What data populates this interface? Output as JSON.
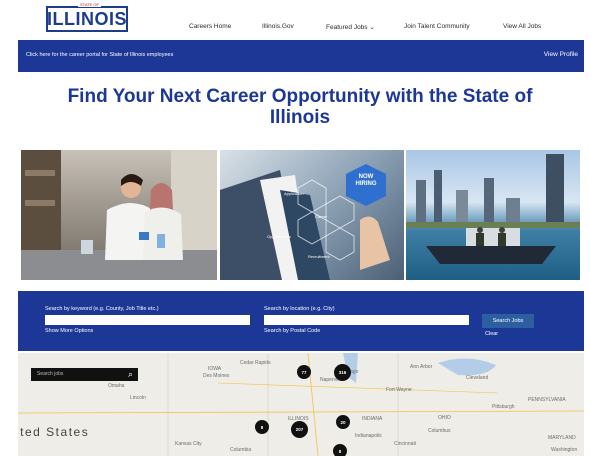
{
  "header": {
    "logo_text": "ILLINOIS",
    "logo_small": "STATE OF",
    "nav": [
      "Careers Home",
      "Illinois.Gov",
      "Featured Jobs ⌄",
      "Join Talent Community",
      "View All Jobs"
    ]
  },
  "employee_bar": {
    "left_link": "Click here for the career portal for State of Illinois employees",
    "right_link": "View Profile"
  },
  "headline": "Find Your Next Career Opportunity with the State of Illinois",
  "photos": {
    "middle": {
      "badge": "NOW HIRING",
      "hex_labels": [
        "Career",
        "Opportunities",
        "Application",
        "Recruitment"
      ]
    }
  },
  "search": {
    "keyword_label": "Search by keyword (e.g. County, Job Title etc.)",
    "keyword_value": "",
    "location_label": "Search by location (e.g. City)",
    "location_value": "",
    "show_more": "Show More Options",
    "postal": "Search by Postal Code",
    "button": "Search Jobs",
    "clear": "Clear"
  },
  "map": {
    "search_placeholder": "Search jobs",
    "country_label": "ited States",
    "places": [
      "IOWA",
      "Des Moines",
      "Cedar Rapids",
      "Naperville",
      "Chicago",
      "Fort Wayne",
      "Ann Arbor",
      "Cleveland",
      "Lincoln",
      "Omaha",
      "Pittsburgh",
      "PENNSYLVANIA",
      "ILLINOIS",
      "INDIANA",
      "OHIO",
      "Columbus",
      "Indianapolis",
      "Cincinnati",
      "Kansas City",
      "Columbia",
      "MARYLAND",
      "Washington"
    ],
    "markers": [
      "77",
      "316",
      "20",
      "8",
      "207",
      "8"
    ]
  },
  "colors": {
    "brand_blue": "#1c3796",
    "button_blue": "#2d5fa0"
  }
}
